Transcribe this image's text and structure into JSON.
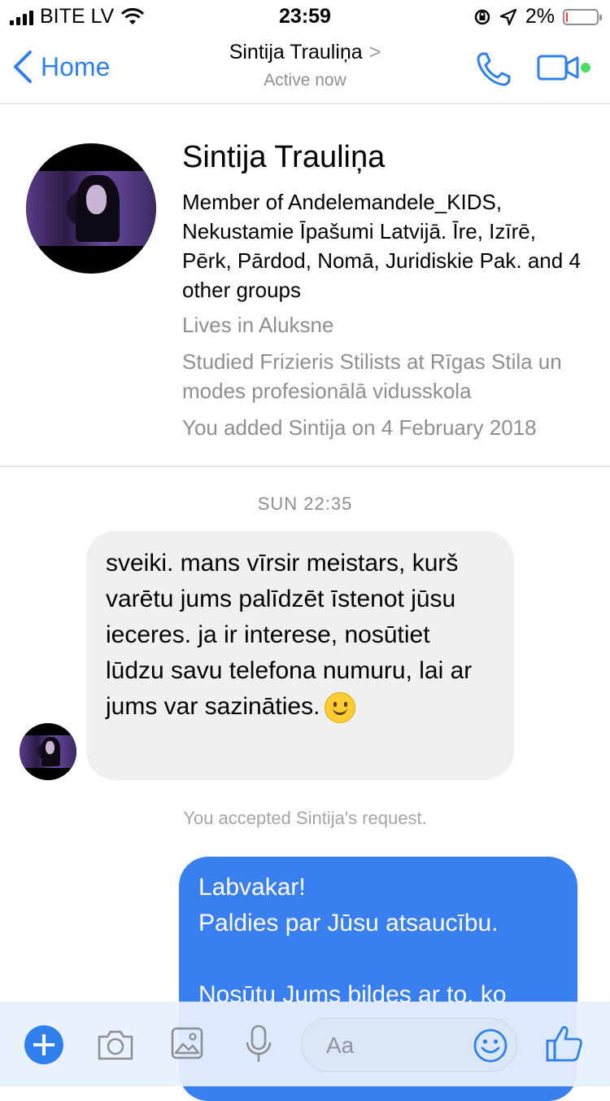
{
  "status_bar": {
    "carrier": "BITE LV",
    "time": "23:59",
    "battery_percent": "2%",
    "battery_level": 0.02
  },
  "nav": {
    "back_label": "Home",
    "title": "Sintija Trauliņa",
    "title_chevron": ">",
    "subtitle": "Active now"
  },
  "profile": {
    "name": "Sintija Trauliņa",
    "groups": "Member of Andelemandele_KIDS, Nekustamie Īpašumi Latvijā. Īre, Izīrē, Pērk, Pārdod, Nomā, Juridiskie Pak. and 4 other groups",
    "lives": "Lives in Aluksne",
    "studied": "Studied Frizieris Stilists at Rīgas Stila un modes profesionālā vidusskola",
    "added": "You added Sintija on 4 February 2018"
  },
  "conversation": {
    "timestamp": "SUN 22:35",
    "incoming_message": "sveiki. mans vīrsir meistars, kurš varētu jums palīdzēt īstenot jūsu ieceres. ja ir interese, nosūtiet lūdzu savu telefona numuru, lai ar jums var sazināties.",
    "system_note": "You accepted Sintija's request.",
    "outgoing_message": "Labvakar!\nPaldies par Jūsu atsaucību.\n\nNosūtu Jums bildes ar to, ko"
  },
  "composer": {
    "placeholder": "Aa"
  },
  "colors": {
    "accent": "#2f80ed",
    "outgoing_bubble": "#3a7ff0",
    "incoming_bubble": "#f1f0f0",
    "online_dot": "#4cd964",
    "battery_low": "#ff3b30"
  }
}
